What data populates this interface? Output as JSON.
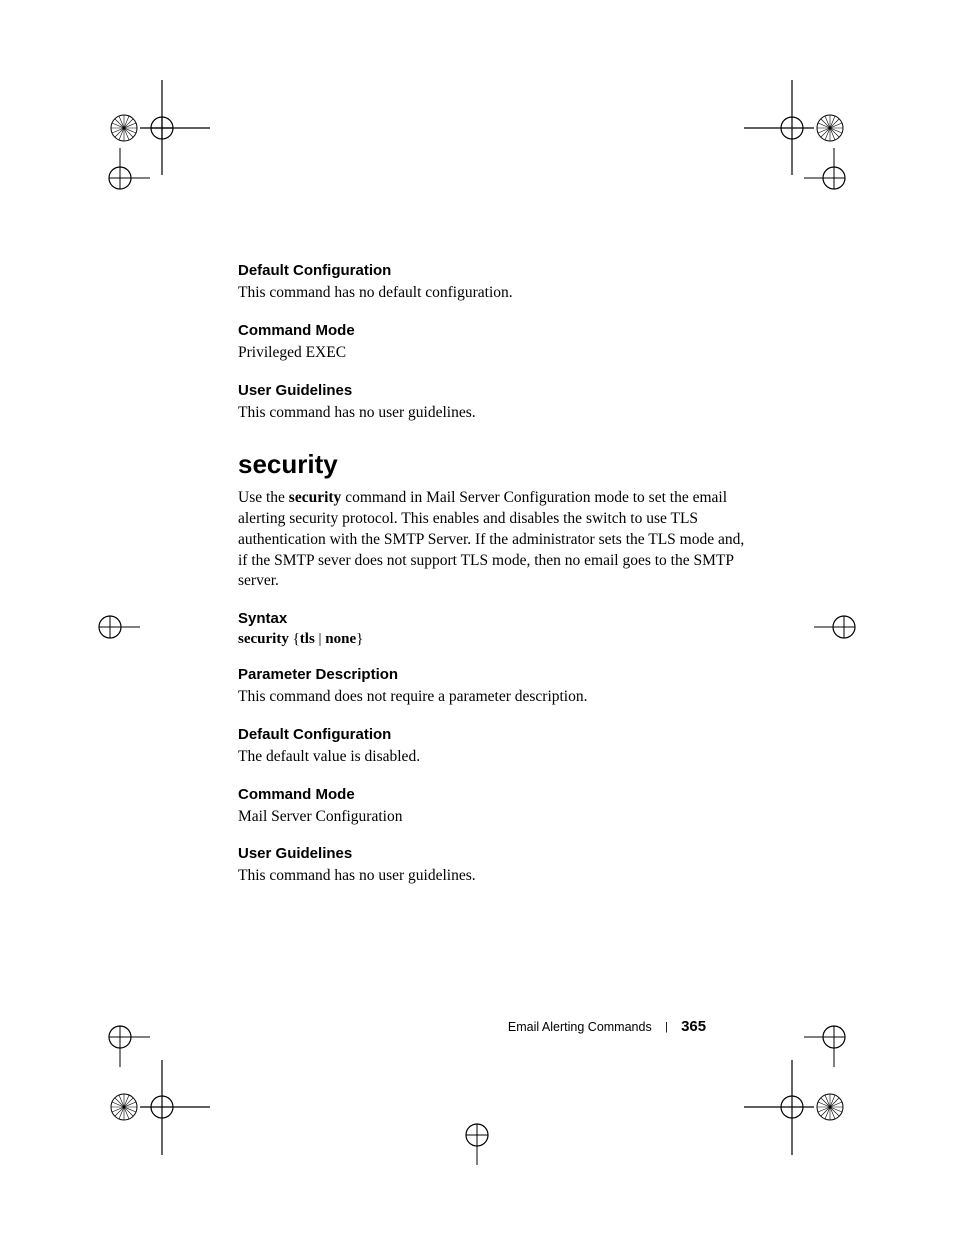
{
  "sections": {
    "defconf1": {
      "heading": "Default Configuration",
      "body": "This command has no default configuration."
    },
    "cmdmode1": {
      "heading": "Command Mode",
      "body": "Privileged EXEC"
    },
    "userguide1": {
      "heading": "User Guidelines",
      "body": "This command has no user guidelines."
    },
    "title": "security",
    "intro_pre": "Use the ",
    "intro_bold": "security",
    "intro_post": " command in Mail Server Configuration mode to set the email alerting security protocol. This enables and disables the switch to use TLS authentication with the SMTP Server. If the administrator sets the TLS mode and, if the SMTP sever does not support TLS mode, then no email goes to the SMTP server.",
    "syntax": {
      "heading": "Syntax",
      "cmd_bold1": "security",
      "cmd_plain": " {",
      "cmd_bold2": "tls",
      "cmd_mid": " | ",
      "cmd_bold3": "none",
      "cmd_end": "}"
    },
    "paramdesc": {
      "heading": "Parameter Description",
      "body": "This command does not require a parameter description."
    },
    "defconf2": {
      "heading": "Default Configuration",
      "body": "The default value is disabled."
    },
    "cmdmode2": {
      "heading": "Command Mode",
      "body": "Mail Server Configuration"
    },
    "userguide2": {
      "heading": "User Guidelines",
      "body": "This command has no user guidelines."
    }
  },
  "footer": {
    "label": "Email Alerting Commands",
    "page": "365"
  }
}
